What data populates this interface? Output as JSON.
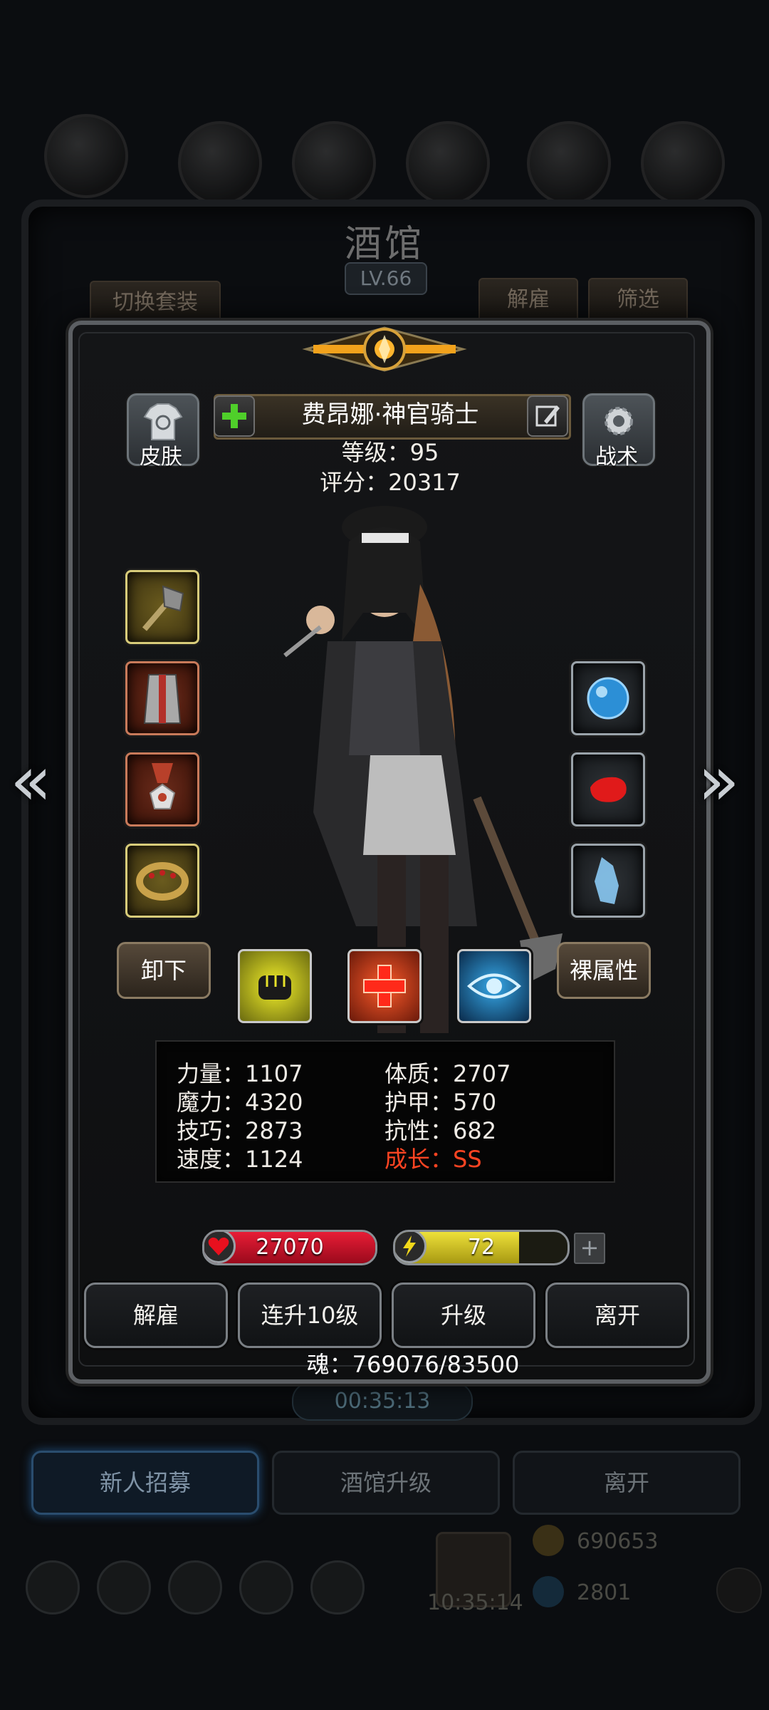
{
  "background": {
    "title": "酒馆",
    "level": "LV.66",
    "switch_outfit_label": "切换套装",
    "dismiss_label": "解雇",
    "filter_label": "筛选",
    "timer": "00:35:13",
    "tabs": [
      "新人招募",
      "酒馆升级",
      "离开"
    ],
    "gold": "690653",
    "gems": "2801",
    "clock": "10:35:14"
  },
  "hero": {
    "name": "费昂娜·神官骑士",
    "level_line": "等级：95",
    "score_line": "评分：20317",
    "skin_label": "皮肤",
    "tactics_label": "战术",
    "unequip_label": "卸下",
    "base_attr_label": "裸属性"
  },
  "equipment_left": [
    {
      "icon": "mace-icon"
    },
    {
      "icon": "armor-icon"
    },
    {
      "icon": "medal-icon"
    },
    {
      "icon": "ring-icon"
    }
  ],
  "equipment_right": [
    {
      "icon": "blue-orb-icon"
    },
    {
      "icon": "red-gem-icon"
    },
    {
      "icon": "ice-crystal-icon"
    }
  ],
  "skills": [
    {
      "icon": "fist-icon"
    },
    {
      "icon": "heal-cross-icon"
    },
    {
      "icon": "eye-icon"
    }
  ],
  "stats": {
    "left": [
      "力量：1107",
      "魔力：4320",
      "技巧：2873",
      "速度：1124"
    ],
    "right": [
      "体质：2707",
      "护甲：570",
      "抗性：682"
    ],
    "growth": "成长：SS"
  },
  "bars": {
    "hp": "27070",
    "hp_fill": 1.0,
    "energy": "72",
    "energy_fill": 0.72
  },
  "actions": [
    "解雇",
    "连升10级",
    "升级",
    "离开"
  ],
  "soul": "魂：769076/83500",
  "colors": {
    "hp": "#c8102e",
    "energy": "#e0d22a",
    "growth": "#ff4422"
  }
}
